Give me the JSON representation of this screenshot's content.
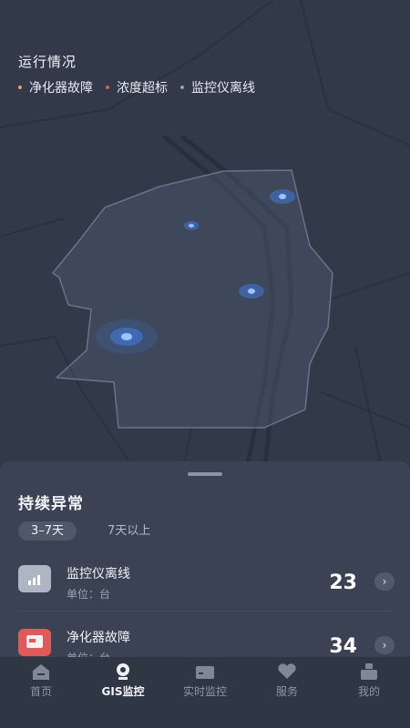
{
  "status": {
    "title": "运行情况",
    "legend": [
      {
        "label": "净化器故障",
        "color": "#f0a44b"
      },
      {
        "label": "浓度超标",
        "color": "#e05a5a"
      },
      {
        "label": "监控仪离线",
        "color": "#9aa3b3"
      }
    ]
  },
  "panel": {
    "title": "持续异常",
    "tabs": [
      {
        "label": "3–7天",
        "active": true
      },
      {
        "label": "7天以上",
        "active": false
      }
    ],
    "rows": [
      {
        "name": "监控仪离线",
        "unit": "单位：台",
        "value": "23",
        "icon": "signal-icon",
        "icon_color": "#aeb6c3"
      },
      {
        "name": "净化器故障",
        "unit": "单位：台",
        "value": "34",
        "icon": "purifier-icon",
        "icon_color": "#e05a5a"
      }
    ]
  },
  "nav": [
    {
      "label": "首页",
      "icon": "home-icon",
      "active": false
    },
    {
      "label": "GIS监控",
      "icon": "camera-icon",
      "active": true
    },
    {
      "label": "实时监控",
      "icon": "monitor-icon",
      "active": false
    },
    {
      "label": "服务",
      "icon": "heart-icon",
      "active": false
    },
    {
      "label": "我的",
      "icon": "user-icon",
      "active": false
    }
  ],
  "colors": {
    "accent_blue": "#3f7ee8",
    "background": "#2f3644",
    "sheet": "#3a4253"
  }
}
